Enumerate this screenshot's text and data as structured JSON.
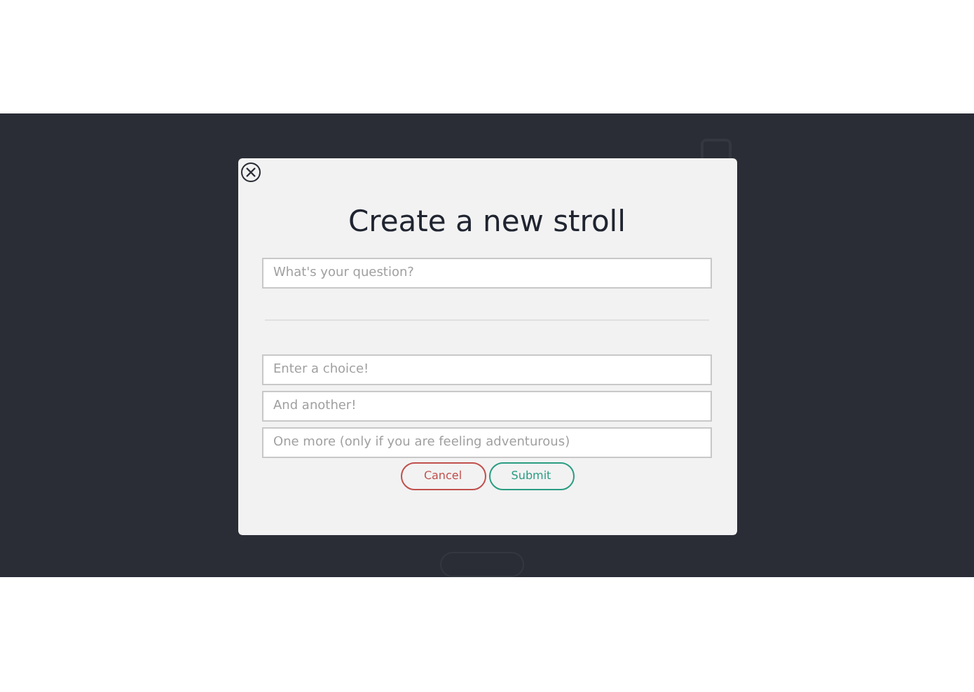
{
  "modal": {
    "title": "Create a new stroll",
    "question": {
      "placeholder": "What's your question?"
    },
    "choices": [
      {
        "placeholder": "Enter a choice!"
      },
      {
        "placeholder": "And another!"
      },
      {
        "placeholder": "One more (only if you are feeling adventurous)"
      }
    ],
    "buttons": [
      {
        "kind": "cancel",
        "label": "Cancel"
      },
      {
        "kind": "submit",
        "label": "Submit"
      }
    ]
  }
}
